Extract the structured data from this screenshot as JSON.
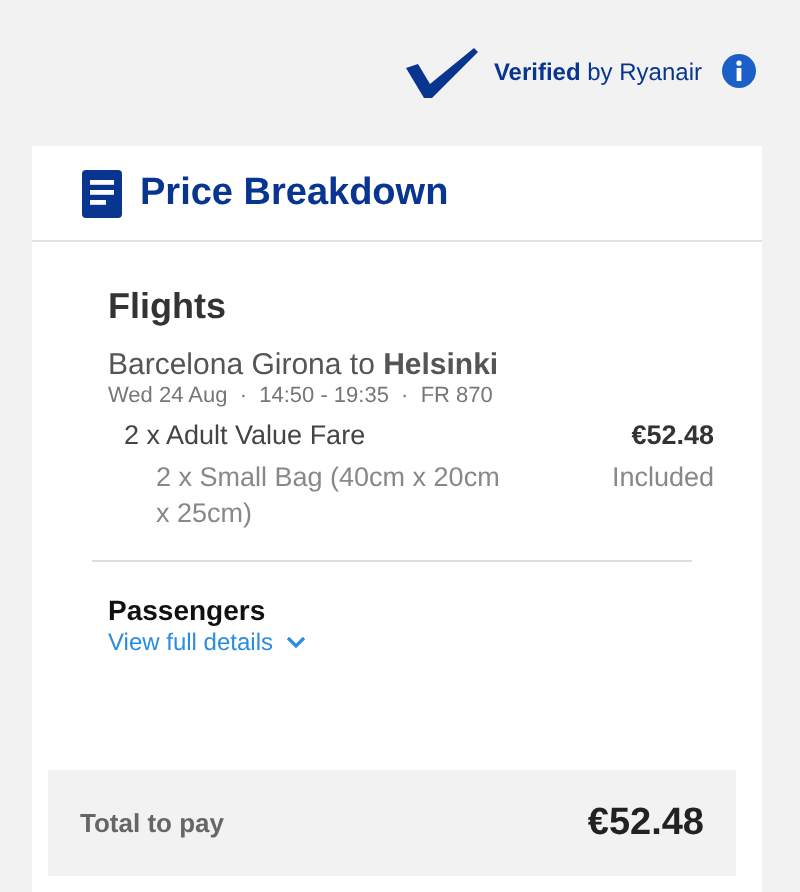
{
  "verified": {
    "text": "**Verified** by Ryanair"
  },
  "card": {
    "title": "Price Breakdown"
  },
  "flights": {
    "heading": "Flights",
    "route": "Barcelona Girona to **Helsinki**",
    "details": "Wed 24 Aug  ·  14:50 - 19:35  ·  FR 870",
    "items": [
      {
        "kind": "fare",
        "label": "2 x Adult Value Fare",
        "price": "€52.48"
      },
      {
        "kind": "extra",
        "label": "2 x Small Bag (40cm x 20cm x 25cm)",
        "price": "Included"
      }
    ]
  },
  "passengers": {
    "heading": "Passengers",
    "link": "View full details",
    "expanded": false
  },
  "total": {
    "label": "Total to pay",
    "amount": "€52.48"
  }
}
